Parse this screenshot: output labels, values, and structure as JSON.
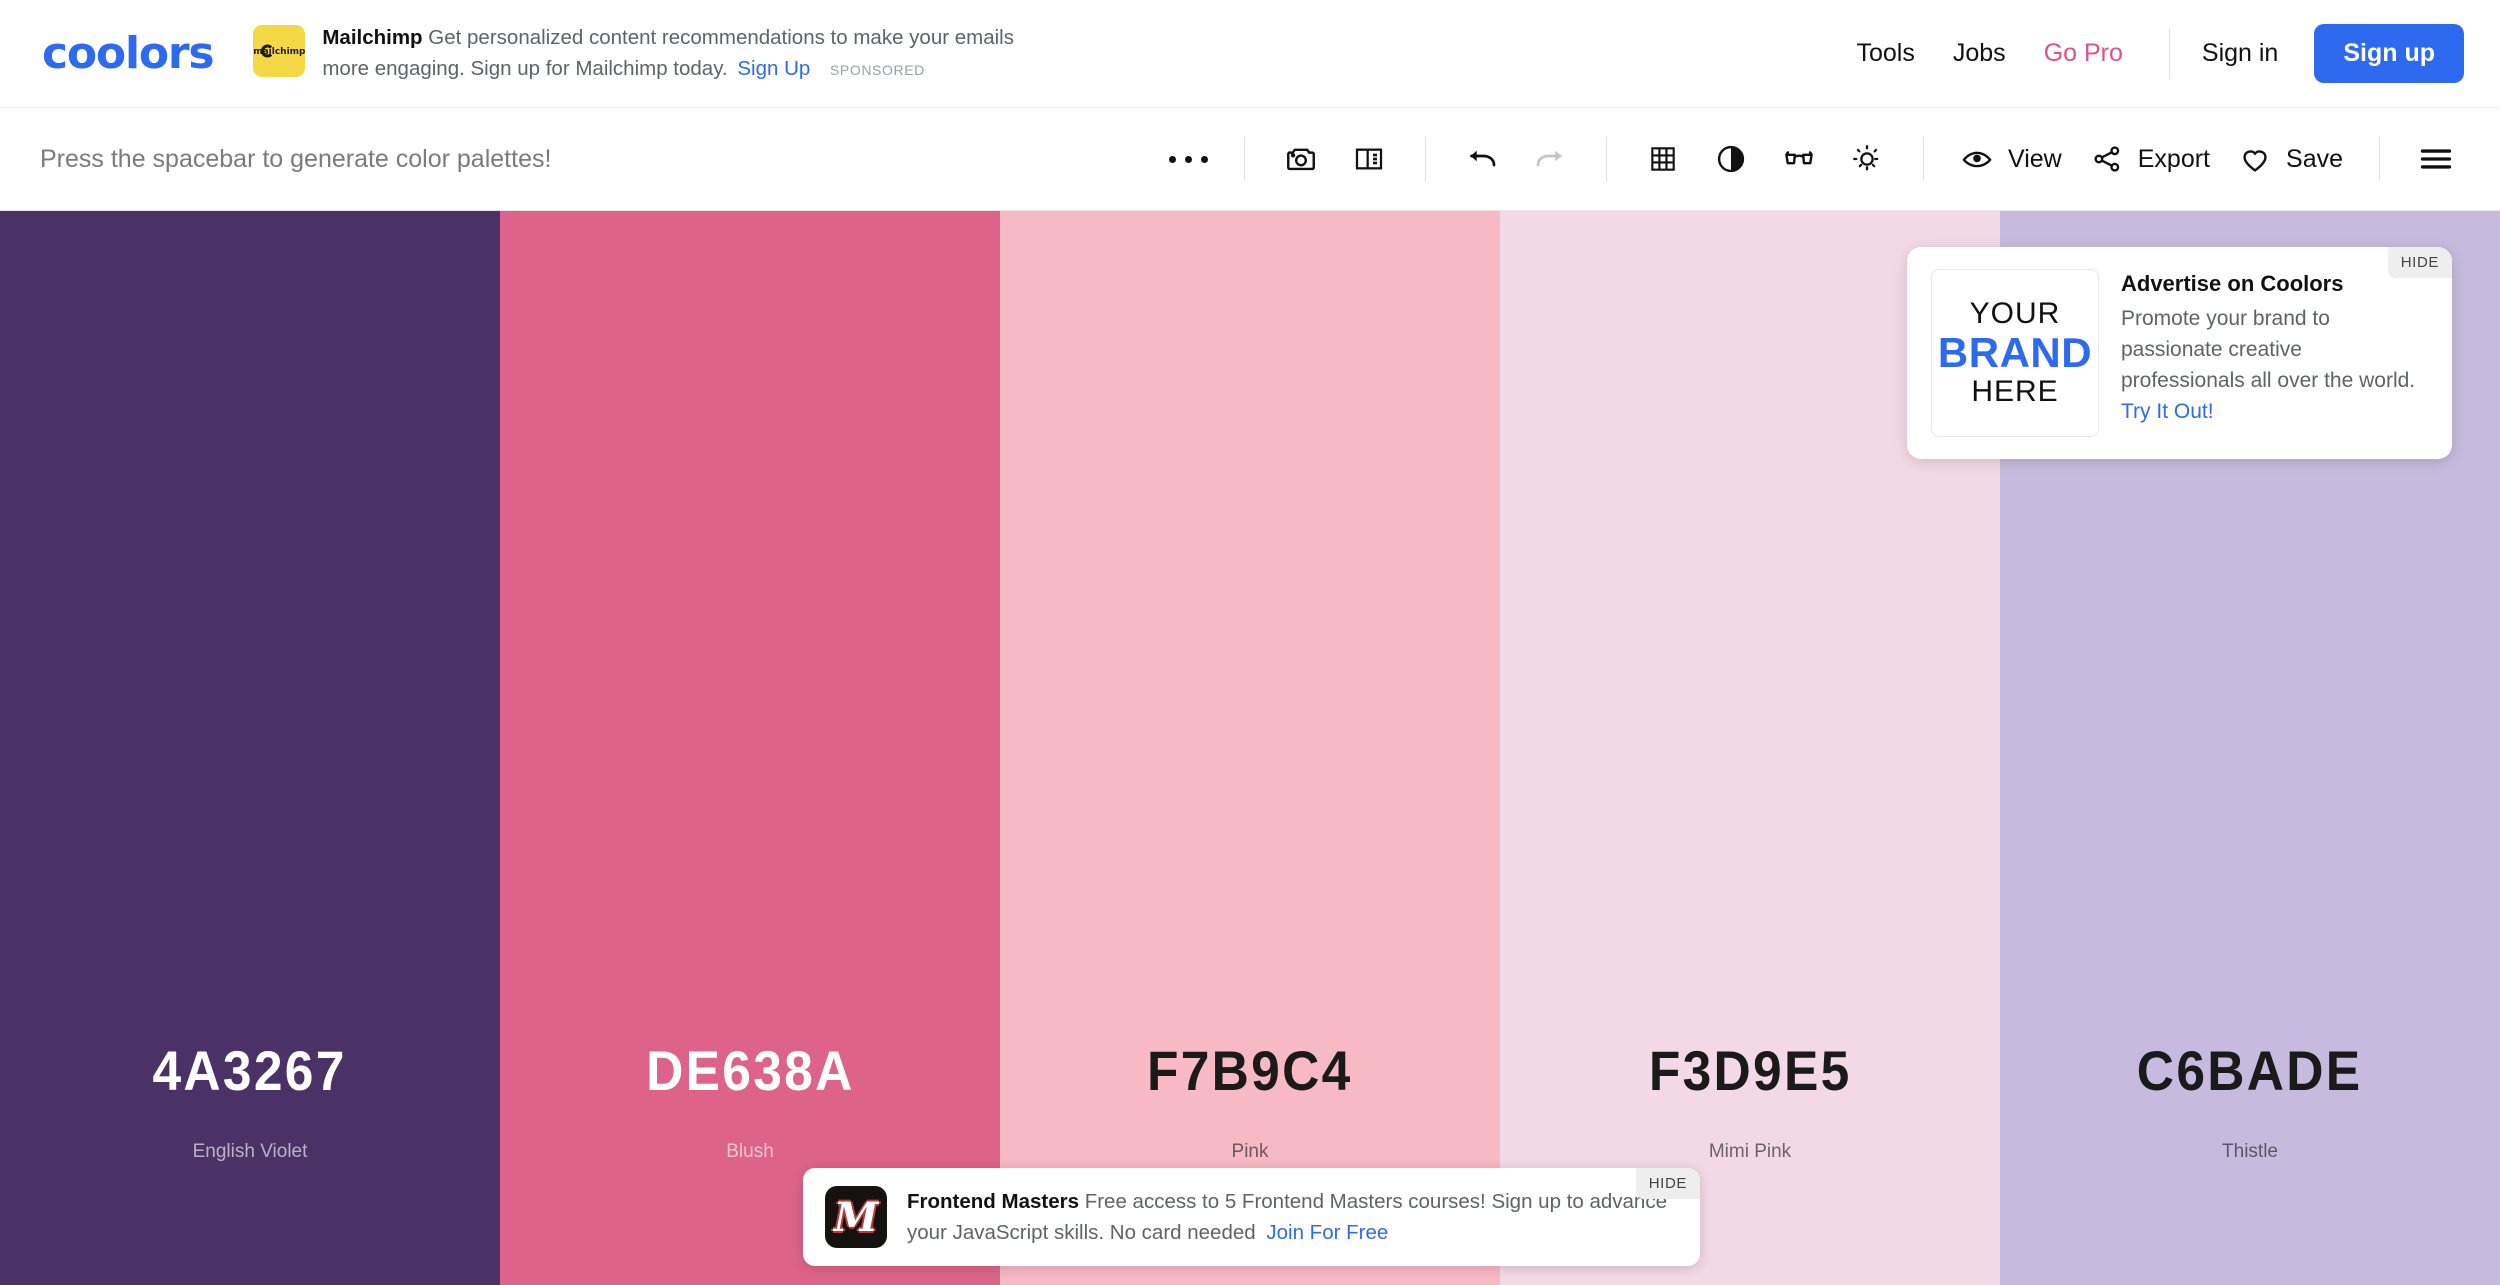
{
  "header": {
    "logo": "coolors",
    "sponsored_ad": {
      "brand": "Mailchimp",
      "text": "Get personalized content recommendations to make your emails more engaging. Sign up for Mailchimp today.",
      "cta": "Sign Up",
      "sponsored_label": "SPONSORED",
      "logo_icon": "mailchimp-icon",
      "logo_bg": "#F5D846"
    },
    "nav": [
      {
        "label": "Tools",
        "name": "tools"
      },
      {
        "label": "Jobs",
        "name": "jobs"
      },
      {
        "label": "Go Pro",
        "name": "go-pro",
        "color": "#E0508B"
      }
    ],
    "sign_in": "Sign in",
    "sign_up": "Sign up",
    "accent": "#2E6AF0"
  },
  "toolbar": {
    "hint": "Press the spacebar to generate color palettes!",
    "icons": [
      {
        "name": "more-options-icon",
        "glyph": "dots"
      },
      {
        "name": "camera-icon",
        "glyph": "camera"
      },
      {
        "name": "layout-panel-icon",
        "glyph": "layout"
      },
      {
        "name": "undo-icon",
        "glyph": "undo",
        "state": "enabled"
      },
      {
        "name": "redo-icon",
        "glyph": "redo",
        "state": "disabled"
      },
      {
        "name": "grid-icon",
        "glyph": "grid"
      },
      {
        "name": "contrast-icon",
        "glyph": "contrast"
      },
      {
        "name": "colorblind-glasses-icon",
        "glyph": "glasses"
      },
      {
        "name": "brightness-icon",
        "glyph": "sun"
      }
    ],
    "view_label": "View",
    "export_label": "Export",
    "save_label": "Save",
    "menu_icon": "hamburger-menu-icon"
  },
  "palette": [
    {
      "hex": "4A3267",
      "color": "#4A3267",
      "name": "English Violet",
      "text": "light"
    },
    {
      "hex": "DE638A",
      "color": "#DE638A",
      "name": "Blush",
      "text": "light"
    },
    {
      "hex": "F7B9C4",
      "color": "#F7B9C4",
      "name": "Pink",
      "text": "dark"
    },
    {
      "hex": "F3D9E5",
      "color": "#F3D9E5",
      "name": "Mimi Pink",
      "text": "dark"
    },
    {
      "hex": "C6BADE",
      "color": "#C6BADE",
      "name": "Thistle",
      "text": "dark"
    }
  ],
  "side_ad": {
    "thumb_line1": "YOUR",
    "thumb_line2": "BRAND",
    "thumb_line3": "HERE",
    "title": "Advertise on Coolors",
    "description": "Promote your brand to passionate creative professionals all over the world.",
    "cta": "Try It Out!",
    "hide_label": "HIDE"
  },
  "bottom_banner": {
    "brand": "Frontend Masters",
    "text": "Free access to 5 Frontend Masters courses! Sign up to advance your JavaScript skills. No card needed",
    "cta": "Join For Free",
    "hide_label": "HIDE",
    "logo_icon": "frontend-masters-icon",
    "logo_letter": "M"
  }
}
